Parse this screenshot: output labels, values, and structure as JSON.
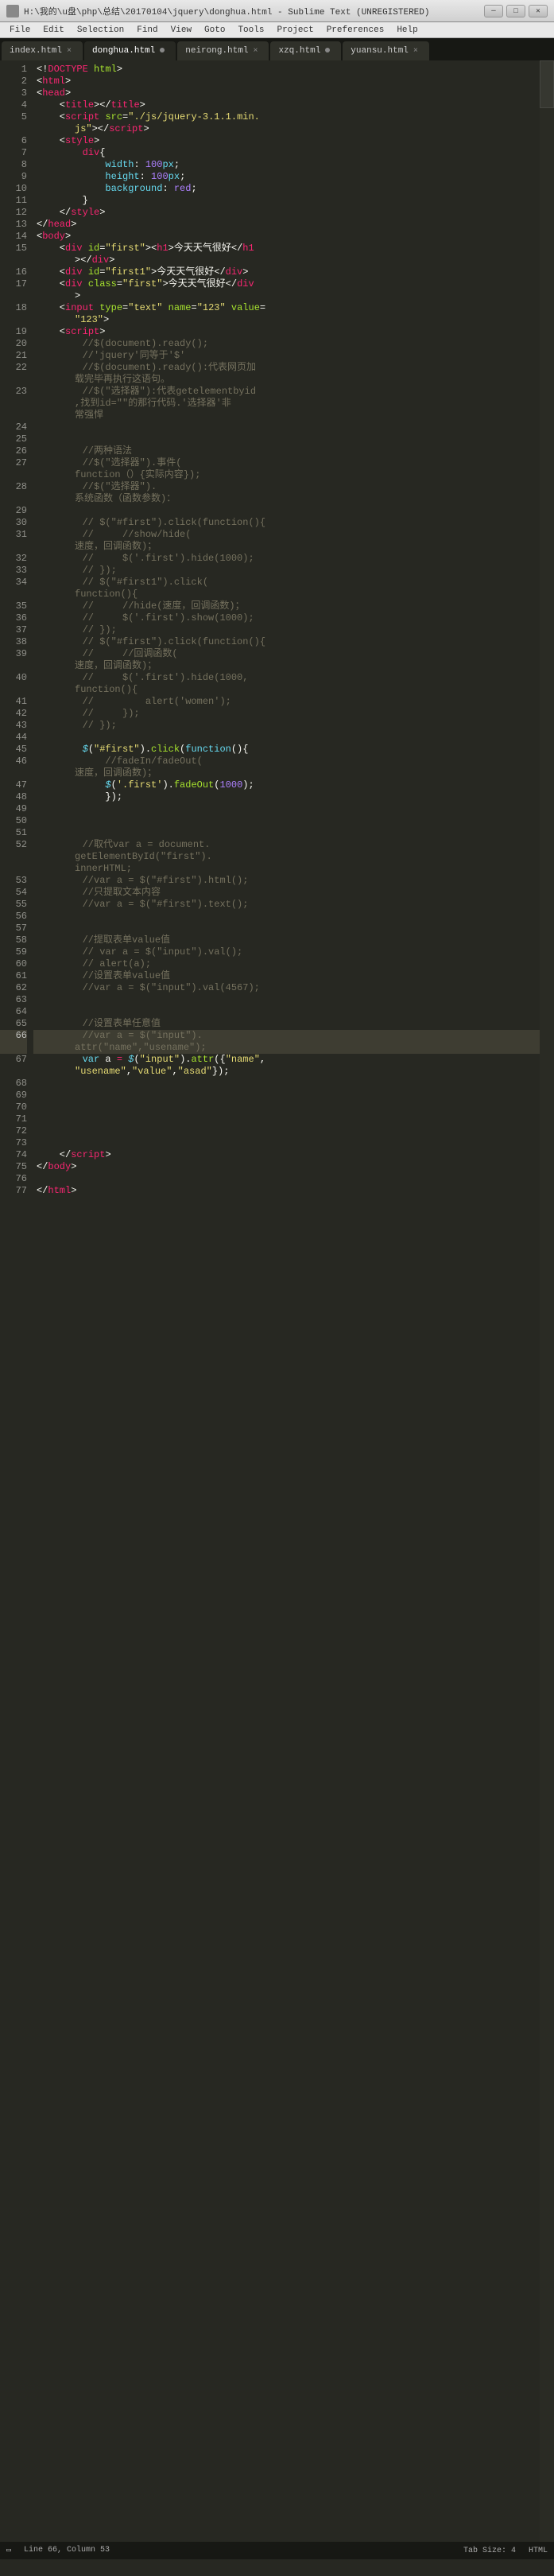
{
  "window": {
    "title": "H:\\我的\\u盘\\php\\总结\\20170104\\jquery\\donghua.html - Sublime Text (UNREGISTERED)"
  },
  "menu": [
    "File",
    "Edit",
    "Selection",
    "Find",
    "View",
    "Goto",
    "Tools",
    "Project",
    "Preferences",
    "Help"
  ],
  "tabs": [
    {
      "label": "index.html",
      "active": false,
      "dirty": false
    },
    {
      "label": "donghua.html",
      "active": true,
      "dirty": true
    },
    {
      "label": "neirong.html",
      "active": false,
      "dirty": false
    },
    {
      "label": "xzq.html",
      "active": false,
      "dirty": true
    },
    {
      "label": "yuansu.html",
      "active": false,
      "dirty": false
    }
  ],
  "status": {
    "left": "Line 66, Column 53",
    "tab_size": "Tab Size: 4",
    "syntax": "HTML"
  },
  "highlighted_line": 66,
  "code_lines": [
    {
      "n": 1,
      "seg": [
        [
          "p",
          "<!"
        ],
        [
          "t",
          "DOCTYPE"
        ],
        [
          "p",
          " "
        ],
        [
          "ta",
          "html"
        ],
        [
          "p",
          ">"
        ]
      ]
    },
    {
      "n": 2,
      "seg": [
        [
          "p",
          "<"
        ],
        [
          "t",
          "html"
        ],
        [
          "p",
          ">"
        ]
      ]
    },
    {
      "n": 3,
      "seg": [
        [
          "p",
          "<"
        ],
        [
          "t",
          "head"
        ],
        [
          "p",
          ">"
        ]
      ]
    },
    {
      "n": 4,
      "seg": [
        [
          "p",
          "    <"
        ],
        [
          "t",
          "title"
        ],
        [
          "p",
          "></"
        ],
        [
          "t",
          "title"
        ],
        [
          "p",
          ">"
        ]
      ]
    },
    {
      "n": 5,
      "seg": [
        [
          "p",
          "    <"
        ],
        [
          "t",
          "script"
        ],
        [
          "p",
          " "
        ],
        [
          "ta",
          "src"
        ],
        [
          "p",
          "="
        ],
        [
          "s",
          "\"./js/jquery-3.1.1.min."
        ]
      ],
      "wrap": [
        [
          [
            "s",
            "js\""
          ],
          [
            "p",
            "></"
          ],
          [
            "t",
            "script"
          ],
          [
            "p",
            ">"
          ]
        ]
      ]
    },
    {
      "n": 6,
      "seg": [
        [
          "p",
          "    <"
        ],
        [
          "t",
          "style"
        ],
        [
          "p",
          ">"
        ]
      ]
    },
    {
      "n": 7,
      "seg": [
        [
          "p",
          "        "
        ],
        [
          "sel",
          "div"
        ],
        [
          "p",
          "{"
        ]
      ]
    },
    {
      "n": 8,
      "seg": [
        [
          "p",
          "            "
        ],
        [
          "pr",
          "width"
        ],
        [
          "p",
          ": "
        ],
        [
          "n",
          "100"
        ],
        [
          "st",
          "px"
        ],
        [
          "p",
          ";"
        ]
      ]
    },
    {
      "n": 9,
      "seg": [
        [
          "p",
          "            "
        ],
        [
          "pr",
          "height"
        ],
        [
          "p",
          ": "
        ],
        [
          "n",
          "100"
        ],
        [
          "st",
          "px"
        ],
        [
          "p",
          ";"
        ]
      ]
    },
    {
      "n": 10,
      "seg": [
        [
          "p",
          "            "
        ],
        [
          "pr",
          "background"
        ],
        [
          "p",
          ": "
        ],
        [
          "cn",
          "red"
        ],
        [
          "p",
          ";"
        ]
      ]
    },
    {
      "n": 11,
      "seg": [
        [
          "p",
          "        }"
        ]
      ]
    },
    {
      "n": 12,
      "seg": [
        [
          "p",
          "    </"
        ],
        [
          "t",
          "style"
        ],
        [
          "p",
          ">"
        ]
      ]
    },
    {
      "n": 13,
      "seg": [
        [
          "p",
          "</"
        ],
        [
          "t",
          "head"
        ],
        [
          "p",
          ">"
        ]
      ]
    },
    {
      "n": 14,
      "seg": [
        [
          "p",
          "<"
        ],
        [
          "t",
          "body"
        ],
        [
          "p",
          ">"
        ]
      ]
    },
    {
      "n": 15,
      "seg": [
        [
          "p",
          "    <"
        ],
        [
          "t",
          "div"
        ],
        [
          "p",
          " "
        ],
        [
          "ta",
          "id"
        ],
        [
          "p",
          "="
        ],
        [
          "s",
          "\"first\""
        ],
        [
          "p",
          "><"
        ],
        [
          "t",
          "h1"
        ],
        [
          "p",
          ">今天天气很好</"
        ],
        [
          "t",
          "h1"
        ]
      ],
      "wrap": [
        [
          [
            "p",
            "></"
          ],
          [
            "t",
            "div"
          ],
          [
            "p",
            ">"
          ]
        ]
      ]
    },
    {
      "n": 16,
      "seg": [
        [
          "p",
          "    <"
        ],
        [
          "t",
          "div"
        ],
        [
          "p",
          " "
        ],
        [
          "ta",
          "id"
        ],
        [
          "p",
          "="
        ],
        [
          "s",
          "\"first1\""
        ],
        [
          "p",
          ">今天天气很好</"
        ],
        [
          "t",
          "div"
        ],
        [
          "p",
          ">"
        ]
      ]
    },
    {
      "n": 17,
      "seg": [
        [
          "p",
          "    <"
        ],
        [
          "t",
          "div"
        ],
        [
          "p",
          " "
        ],
        [
          "ta",
          "class"
        ],
        [
          "p",
          "="
        ],
        [
          "s",
          "\"first\""
        ],
        [
          "p",
          ">今天天气很好</"
        ],
        [
          "t",
          "div"
        ]
      ],
      "wrap": [
        [
          [
            "p",
            ">"
          ]
        ]
      ]
    },
    {
      "n": 18,
      "seg": [
        [
          "p",
          "    <"
        ],
        [
          "t",
          "input"
        ],
        [
          "p",
          " "
        ],
        [
          "ta",
          "type"
        ],
        [
          "p",
          "="
        ],
        [
          "s",
          "\"text\""
        ],
        [
          "p",
          " "
        ],
        [
          "ta",
          "name"
        ],
        [
          "p",
          "="
        ],
        [
          "s",
          "\"123\""
        ],
        [
          "p",
          " "
        ],
        [
          "ta",
          "value"
        ],
        [
          "p",
          "="
        ]
      ],
      "wrap": [
        [
          [
            "s",
            "\"123\""
          ],
          [
            "p",
            ">"
          ]
        ]
      ]
    },
    {
      "n": 19,
      "seg": [
        [
          "p",
          "    <"
        ],
        [
          "t",
          "script"
        ],
        [
          "p",
          ">"
        ]
      ]
    },
    {
      "n": 20,
      "seg": [
        [
          "p",
          "        "
        ],
        [
          "c",
          "//$(document).ready();"
        ]
      ]
    },
    {
      "n": 21,
      "seg": [
        [
          "p",
          "        "
        ],
        [
          "c",
          "//'jquery'同等于'$'"
        ]
      ]
    },
    {
      "n": 22,
      "seg": [
        [
          "p",
          "        "
        ],
        [
          "c",
          "//$(document).ready():代表网页加"
        ]
      ],
      "wrap": [
        [
          [
            "c",
            "载完毕再执行这语句。"
          ]
        ]
      ]
    },
    {
      "n": 23,
      "seg": [
        [
          "p",
          "        "
        ],
        [
          "c",
          "//$(\"选择器\"):代表getelementbyid"
        ]
      ],
      "wrap": [
        [
          [
            "c",
            ",找到id=\"\"的那行代码.'选择器'非"
          ]
        ],
        [
          [
            "c",
            "常强悍"
          ]
        ]
      ]
    },
    {
      "n": 24,
      "seg": [
        [
          "p",
          ""
        ]
      ]
    },
    {
      "n": 25,
      "seg": [
        [
          "p",
          ""
        ]
      ]
    },
    {
      "n": 26,
      "seg": [
        [
          "p",
          "        "
        ],
        [
          "c",
          "//两种语法"
        ]
      ]
    },
    {
      "n": 27,
      "seg": [
        [
          "p",
          "        "
        ],
        [
          "c",
          "//$(\"选择器\").事件("
        ]
      ],
      "wrap": [
        [
          [
            "c",
            "function（）{实际内容});"
          ]
        ]
      ]
    },
    {
      "n": 28,
      "seg": [
        [
          "p",
          "        "
        ],
        [
          "c",
          "//$(\"选择器\")."
        ]
      ],
      "wrap": [
        [
          [
            "c",
            "系统函数（函数参数)："
          ]
        ]
      ]
    },
    {
      "n": 29,
      "seg": [
        [
          "p",
          ""
        ]
      ]
    },
    {
      "n": 30,
      "seg": [
        [
          "p",
          "        "
        ],
        [
          "c",
          "// $(\"#first\").click(function(){"
        ]
      ]
    },
    {
      "n": 31,
      "seg": [
        [
          "p",
          "        "
        ],
        [
          "c",
          "//     //show/hide("
        ]
      ],
      "wrap": [
        [
          [
            "c",
            "速度，回调函数)；"
          ]
        ]
      ]
    },
    {
      "n": 32,
      "seg": [
        [
          "p",
          "        "
        ],
        [
          "c",
          "//     $('.first').hide(1000);"
        ]
      ]
    },
    {
      "n": 33,
      "seg": [
        [
          "p",
          "        "
        ],
        [
          "c",
          "// });"
        ]
      ]
    },
    {
      "n": 34,
      "seg": [
        [
          "p",
          "        "
        ],
        [
          "c",
          "// $(\"#first1\").click("
        ]
      ],
      "wrap": [
        [
          [
            "c",
            "function(){"
          ]
        ]
      ]
    },
    {
      "n": 35,
      "seg": [
        [
          "p",
          "        "
        ],
        [
          "c",
          "//     //hide(速度，回调函数)；"
        ]
      ]
    },
    {
      "n": 36,
      "seg": [
        [
          "p",
          "        "
        ],
        [
          "c",
          "//     $('.first').show(1000);"
        ]
      ]
    },
    {
      "n": 37,
      "seg": [
        [
          "p",
          "        "
        ],
        [
          "c",
          "// });"
        ]
      ]
    },
    {
      "n": 38,
      "seg": [
        [
          "p",
          "        "
        ],
        [
          "c",
          "// $(\"#first\").click(function(){"
        ]
      ]
    },
    {
      "n": 39,
      "seg": [
        [
          "p",
          "        "
        ],
        [
          "c",
          "//     //回调函数("
        ]
      ],
      "wrap": [
        [
          [
            "c",
            "速度，回调函数)；"
          ]
        ]
      ]
    },
    {
      "n": 40,
      "seg": [
        [
          "p",
          "        "
        ],
        [
          "c",
          "//     $('.first').hide(1000,"
        ]
      ],
      "wrap": [
        [
          [
            "c",
            "function(){"
          ]
        ]
      ]
    },
    {
      "n": 41,
      "seg": [
        [
          "p",
          "        "
        ],
        [
          "c",
          "//         alert('women');"
        ]
      ]
    },
    {
      "n": 42,
      "seg": [
        [
          "p",
          "        "
        ],
        [
          "c",
          "//     });"
        ]
      ]
    },
    {
      "n": 43,
      "seg": [
        [
          "p",
          "        "
        ],
        [
          "c",
          "// });"
        ]
      ]
    },
    {
      "n": 44,
      "seg": [
        [
          "p",
          ""
        ]
      ]
    },
    {
      "n": 45,
      "seg": [
        [
          "p",
          "        "
        ],
        [
          "k",
          "$"
        ],
        [
          "p",
          "("
        ],
        [
          "s",
          "\"#first\""
        ],
        [
          "p",
          ")."
        ],
        [
          "fn",
          "click"
        ],
        [
          "p",
          "("
        ],
        [
          "st",
          "function"
        ],
        [
          "p",
          "(){"
        ]
      ]
    },
    {
      "n": 46,
      "seg": [
        [
          "p",
          "            "
        ],
        [
          "c",
          "//fadeIn/fadeOut("
        ]
      ],
      "wrap": [
        [
          [
            "c",
            "速度，回调函数)；"
          ]
        ]
      ]
    },
    {
      "n": 47,
      "seg": [
        [
          "p",
          "            "
        ],
        [
          "k",
          "$"
        ],
        [
          "p",
          "("
        ],
        [
          "s",
          "'.first'"
        ],
        [
          "p",
          ")."
        ],
        [
          "fn",
          "fadeOut"
        ],
        [
          "p",
          "("
        ],
        [
          "n",
          "1000"
        ],
        [
          "p",
          ");"
        ]
      ]
    },
    {
      "n": 48,
      "seg": [
        [
          "p",
          "            });"
        ]
      ]
    },
    {
      "n": 49,
      "seg": [
        [
          "p",
          ""
        ]
      ]
    },
    {
      "n": 50,
      "seg": [
        [
          "p",
          ""
        ]
      ]
    },
    {
      "n": 51,
      "seg": [
        [
          "p",
          ""
        ]
      ]
    },
    {
      "n": 52,
      "seg": [
        [
          "p",
          "        "
        ],
        [
          "c",
          "//取代var a = document."
        ]
      ],
      "wrap": [
        [
          [
            "c",
            "getElementById(\"first\")."
          ]
        ],
        [
          [
            "c",
            "innerHTML;"
          ]
        ]
      ]
    },
    {
      "n": 53,
      "seg": [
        [
          "p",
          "        "
        ],
        [
          "c",
          "//var a = $(\"#first\").html();"
        ]
      ]
    },
    {
      "n": 54,
      "seg": [
        [
          "p",
          "        "
        ],
        [
          "c",
          "//只提取文本内容"
        ]
      ]
    },
    {
      "n": 55,
      "seg": [
        [
          "p",
          "        "
        ],
        [
          "c",
          "//var a = $(\"#first\").text();"
        ]
      ]
    },
    {
      "n": 56,
      "seg": [
        [
          "p",
          ""
        ]
      ]
    },
    {
      "n": 57,
      "seg": [
        [
          "p",
          ""
        ]
      ]
    },
    {
      "n": 58,
      "seg": [
        [
          "p",
          "        "
        ],
        [
          "c",
          "//提取表单value值"
        ]
      ]
    },
    {
      "n": 59,
      "seg": [
        [
          "p",
          "        "
        ],
        [
          "c",
          "// var a = $(\"input\").val();"
        ]
      ]
    },
    {
      "n": 60,
      "seg": [
        [
          "p",
          "        "
        ],
        [
          "c",
          "// alert(a);"
        ]
      ]
    },
    {
      "n": 61,
      "seg": [
        [
          "p",
          "        "
        ],
        [
          "c",
          "//设置表单value值"
        ]
      ]
    },
    {
      "n": 62,
      "seg": [
        [
          "p",
          "        "
        ],
        [
          "c",
          "//var a = $(\"input\").val(4567);"
        ]
      ]
    },
    {
      "n": 63,
      "seg": [
        [
          "p",
          ""
        ]
      ]
    },
    {
      "n": 64,
      "seg": [
        [
          "p",
          ""
        ]
      ]
    },
    {
      "n": 65,
      "seg": [
        [
          "p",
          "        "
        ],
        [
          "c",
          "//设置表单任意值"
        ]
      ]
    },
    {
      "n": 66,
      "seg": [
        [
          "p",
          "        "
        ],
        [
          "c",
          "//var a = $(\"input\")."
        ]
      ],
      "wrap": [
        [
          [
            "c",
            "attr(\"name\",\"usename\");"
          ]
        ]
      ]
    },
    {
      "n": 67,
      "seg": [
        [
          "p",
          "        "
        ],
        [
          "st",
          "var"
        ],
        [
          "p",
          " a "
        ],
        [
          "op",
          "="
        ],
        [
          "p",
          " "
        ],
        [
          "k",
          "$"
        ],
        [
          "p",
          "("
        ],
        [
          "s",
          "\"input\""
        ],
        [
          "p",
          ")."
        ],
        [
          "fn",
          "attr"
        ],
        [
          "p",
          "({"
        ],
        [
          "s",
          "\"name\""
        ],
        [
          "p",
          ","
        ]
      ],
      "wrap": [
        [
          [
            "s",
            "\"usename\""
          ],
          [
            "p",
            ","
          ],
          [
            "s",
            "\"value\""
          ],
          [
            "p",
            ","
          ],
          [
            "s",
            "\"asad\""
          ],
          [
            "p",
            "});"
          ]
        ]
      ]
    },
    {
      "n": 68,
      "seg": [
        [
          "p",
          ""
        ]
      ]
    },
    {
      "n": 69,
      "seg": [
        [
          "p",
          ""
        ]
      ]
    },
    {
      "n": 70,
      "seg": [
        [
          "p",
          ""
        ]
      ]
    },
    {
      "n": 71,
      "seg": [
        [
          "p",
          ""
        ]
      ]
    },
    {
      "n": 72,
      "seg": [
        [
          "p",
          ""
        ]
      ]
    },
    {
      "n": 73,
      "seg": [
        [
          "p",
          ""
        ]
      ]
    },
    {
      "n": 74,
      "seg": [
        [
          "p",
          "    </"
        ],
        [
          "t",
          "script"
        ],
        [
          "p",
          ">"
        ]
      ]
    },
    {
      "n": 75,
      "seg": [
        [
          "p",
          "</"
        ],
        [
          "t",
          "body"
        ],
        [
          "p",
          ">"
        ]
      ]
    },
    {
      "n": 76,
      "seg": [
        [
          "p",
          ""
        ]
      ]
    },
    {
      "n": 77,
      "seg": [
        [
          "p",
          "</"
        ],
        [
          "t",
          "html"
        ],
        [
          "p",
          ">"
        ]
      ]
    }
  ]
}
